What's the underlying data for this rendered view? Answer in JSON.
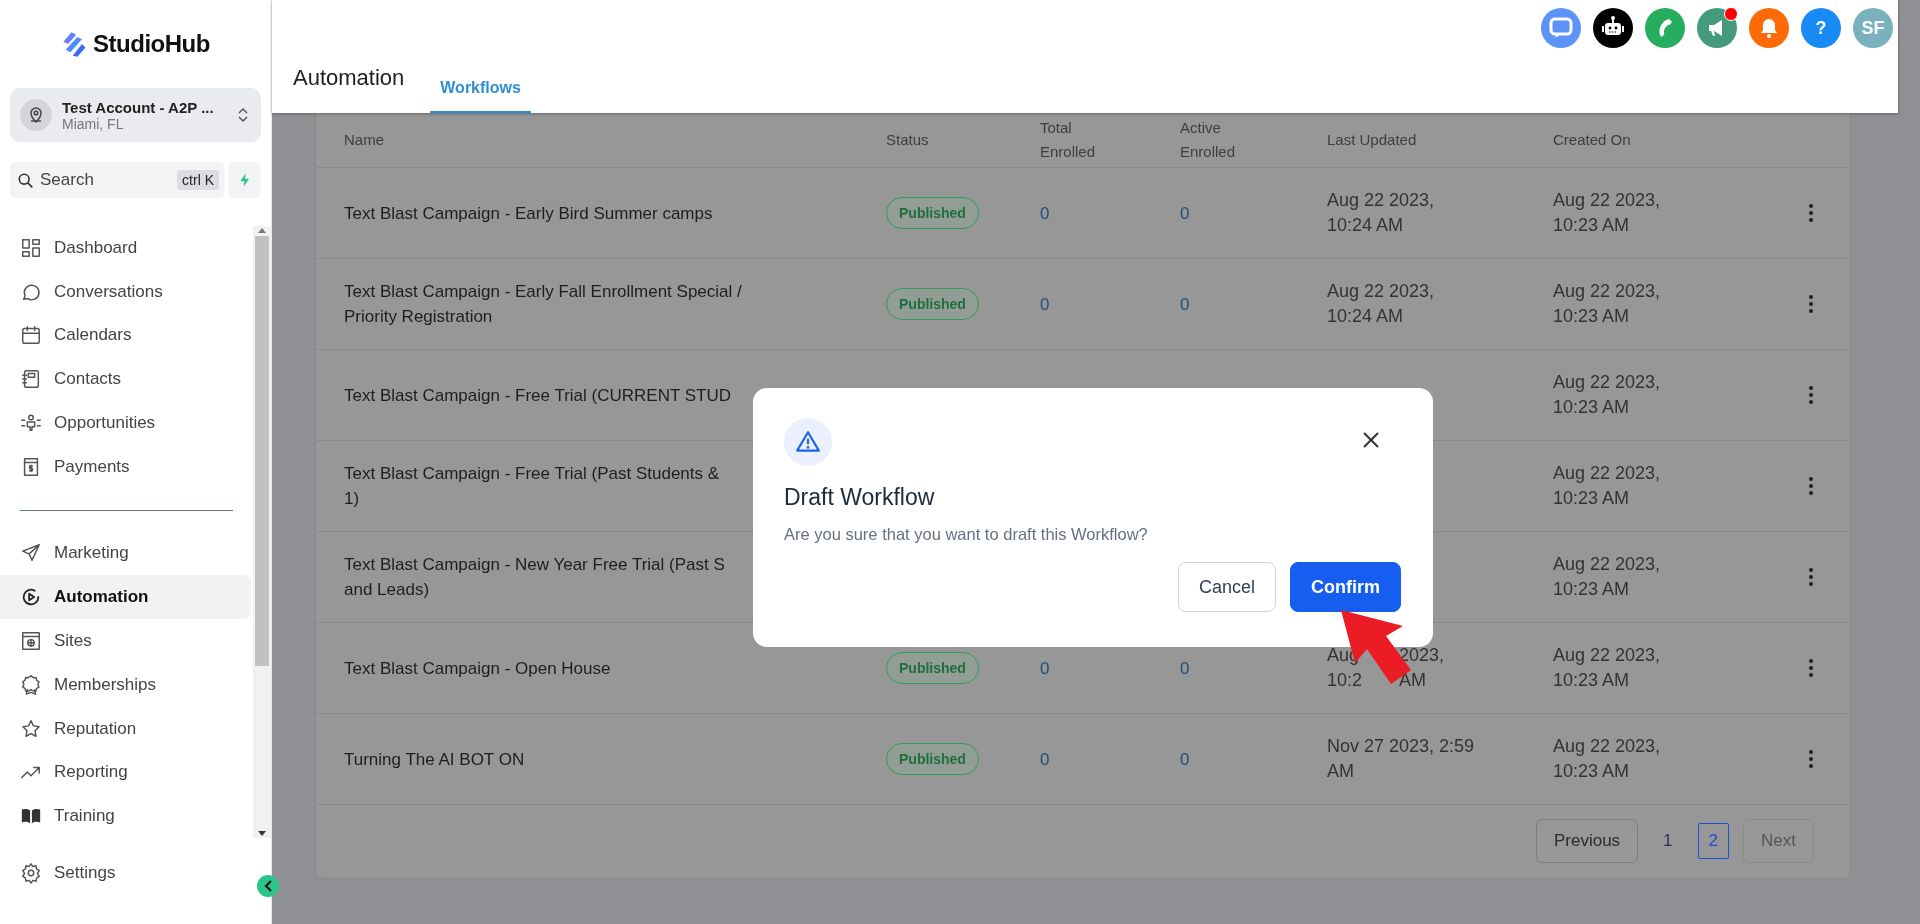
{
  "brand": {
    "name": "StudioHub"
  },
  "account": {
    "name": "Test Account - A2P ...",
    "location": "Miami, FL"
  },
  "search": {
    "placeholder": "Search",
    "shortcut": "ctrl K"
  },
  "nav_main": [
    {
      "label": "Dashboard",
      "selected": false
    },
    {
      "label": "Conversations",
      "selected": false
    },
    {
      "label": "Calendars",
      "selected": false
    },
    {
      "label": "Contacts",
      "selected": false
    },
    {
      "label": "Opportunities",
      "selected": false
    },
    {
      "label": "Payments",
      "selected": false
    }
  ],
  "nav_secondary": [
    {
      "label": "Marketing",
      "selected": false
    },
    {
      "label": "Automation",
      "selected": true
    },
    {
      "label": "Sites",
      "selected": false
    },
    {
      "label": "Memberships",
      "selected": false
    },
    {
      "label": "Reputation",
      "selected": false
    },
    {
      "label": "Reporting",
      "selected": false
    },
    {
      "label": "Training",
      "selected": false
    }
  ],
  "settings": {
    "label": "Settings"
  },
  "toolbar": [
    {
      "kind": "chat",
      "badge": false
    },
    {
      "kind": "bot",
      "badge": false
    },
    {
      "kind": "phone",
      "badge": false
    },
    {
      "kind": "announce",
      "badge": true
    },
    {
      "kind": "bell",
      "badge": false
    },
    {
      "kind": "help",
      "label": "?",
      "badge": false
    },
    {
      "kind": "avatar",
      "label": "SF",
      "badge": false
    }
  ],
  "page": {
    "title": "Automation",
    "tabs": [
      {
        "label": "Workflows",
        "selected": true
      }
    ]
  },
  "table": {
    "columns": [
      "Name",
      "Status",
      "Total\nEnrolled",
      "Active\nEnrolled",
      "Last Updated",
      "Created On"
    ],
    "rows": [
      {
        "name": "Text Blast Campaign - Early Bird Summer camps",
        "status": "Published",
        "total": "0",
        "active": "0",
        "last_updated": "Aug 22 2023,\n10:24 AM",
        "created_on": "Aug 22 2023,\n10:23 AM"
      },
      {
        "name": "Text Blast Campaign - Early Fall Enrollment Special /\nPriority Registration",
        "status": "Published",
        "total": "0",
        "active": "0",
        "last_updated": "Aug 22 2023,\n10:24 AM",
        "created_on": "Aug 22 2023,\n10:23 AM"
      },
      {
        "name": "Text Blast Campaign - Free Trial (CURRENT STUD",
        "created_on": "Aug 22 2023,\n10:23 AM"
      },
      {
        "name": "Text Blast Campaign - Free Trial (Past Students &\n1)",
        "created_on": "Aug 22 2023,\n10:23 AM"
      },
      {
        "name": "Text Blast Campaign - New Year Free Trial (Past S\nand Leads)",
        "created_on": "Aug 22 2023,\n10:23 AM"
      },
      {
        "name": "Text Blast Campaign - Open House",
        "status": "Published",
        "total": "0",
        "active": "0",
        "last_updated_fragments": [
          "Aug",
          "2023,",
          "10:2",
          "AM"
        ],
        "created_on": "Aug 22 2023,\n10:23 AM"
      },
      {
        "name": "Turning The AI BOT ON",
        "status": "Published",
        "total": "0",
        "active": "0",
        "last_updated": "Nov 27 2023, 2:59\nAM",
        "created_on": "Aug 22 2023,\n10:23 AM"
      }
    ]
  },
  "pagination": {
    "previous": "Previous",
    "pages": [
      {
        "label": "1",
        "selected": false
      },
      {
        "label": "2",
        "selected": true
      }
    ],
    "next": "Next",
    "next_disabled": true
  },
  "dialog": {
    "title": "Draft Workflow",
    "message": "Are you sure that you want to draft this Workflow?",
    "buttons": [
      {
        "label": "Cancel",
        "kind": "secondary"
      },
      {
        "label": "Confirm",
        "kind": "primary"
      }
    ]
  }
}
